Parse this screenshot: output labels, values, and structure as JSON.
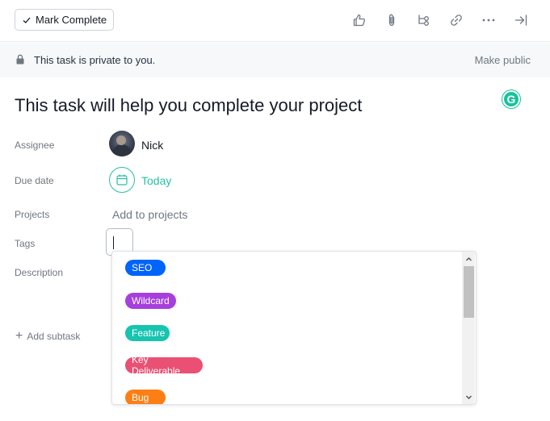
{
  "toolbar": {
    "mark_complete_label": "Mark Complete",
    "icons": [
      "thumbs-up-icon",
      "paperclip-icon",
      "subtask-icon",
      "link-icon",
      "more-icon",
      "close-panel-icon"
    ]
  },
  "privacy": {
    "message": "This task is private to you.",
    "make_public_label": "Make public"
  },
  "task": {
    "title": "This task will help you complete your project"
  },
  "fields": {
    "assignee_label": "Assignee",
    "assignee_name": "Nick",
    "due_date_label": "Due date",
    "due_date_value": "Today",
    "projects_label": "Projects",
    "projects_placeholder": "Add to projects",
    "tags_label": "Tags",
    "description_label": "Description"
  },
  "add_subtask_label": "Add subtask",
  "grammarly_letter": "G",
  "tag_options": [
    {
      "label": "SEO",
      "color": "#0064fb"
    },
    {
      "label": "Wildcard",
      "color": "#a63fdd"
    },
    {
      "label": "Feature",
      "color": "#16c4b0"
    },
    {
      "label": "Key Deliverable",
      "color": "#ea5073"
    },
    {
      "label": "Bug",
      "color": "#fd7e14"
    }
  ],
  "colors": {
    "accent_green": "#25c1a5",
    "text_muted": "#6f7782"
  }
}
